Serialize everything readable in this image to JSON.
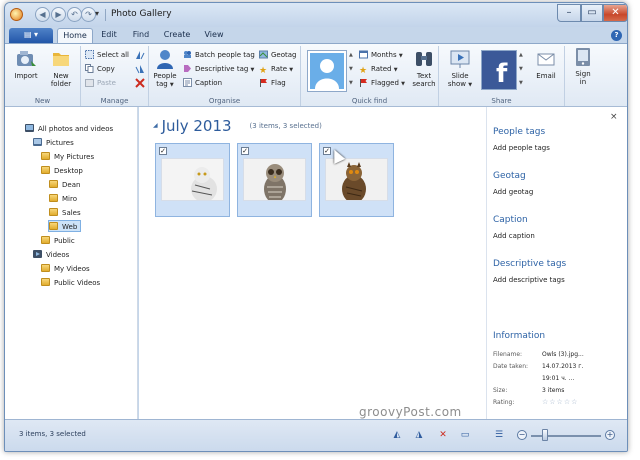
{
  "window": {
    "title": "Photo Gallery",
    "controls": {
      "minimize": "–",
      "maximize": "▭",
      "close": "✕"
    }
  },
  "menu": {
    "file_menu": "▤ ▾",
    "tabs": [
      "Home",
      "Edit",
      "Find",
      "Create",
      "View"
    ],
    "active_tab": "Home"
  },
  "ribbon": {
    "new_group": {
      "label": "New",
      "import": "Import",
      "new_folder_1": "New",
      "new_folder_2": "folder"
    },
    "manage_group": {
      "label": "Manage",
      "select_all": "Select all",
      "copy": "Copy",
      "paste": "Paste"
    },
    "organise_group": {
      "label": "Organise",
      "people_tag_1": "People",
      "people_tag_2": "tag",
      "batch_people_tag": "Batch people tag",
      "descriptive_tag": "Descriptive tag",
      "caption": "Caption",
      "geotag": "Geotag",
      "rate": "Rate",
      "flag": "Flag"
    },
    "quick_find_group": {
      "label": "Quick find",
      "months": "Months",
      "rated": "Rated",
      "flagged": "Flagged",
      "text_search_1": "Text",
      "text_search_2": "search"
    },
    "share_group": {
      "label": "Share",
      "slide_show_1": "Slide",
      "slide_show_2": "show",
      "email": "Email"
    },
    "sign_in": {
      "line1": "Sign",
      "line2": "in"
    }
  },
  "navigation": [
    {
      "label": "All photos and videos",
      "icon": "photos-icon",
      "level": 0
    },
    {
      "label": "Pictures",
      "icon": "pictures-icon",
      "level": 1
    },
    {
      "label": "My Pictures",
      "icon": "folder-icon",
      "level": 2
    },
    {
      "label": "Desktop",
      "icon": "folder-icon",
      "level": 2
    },
    {
      "label": "Dean",
      "icon": "folder-icon",
      "level": 3
    },
    {
      "label": "Miro",
      "icon": "folder-icon",
      "level": 3
    },
    {
      "label": "Sales",
      "icon": "folder-icon",
      "level": 3
    },
    {
      "label": "Web",
      "icon": "folder-icon",
      "level": 3,
      "selected": true
    },
    {
      "label": "Public",
      "icon": "folder-icon",
      "level": 2
    },
    {
      "label": "Videos",
      "icon": "videos-icon",
      "level": 1
    },
    {
      "label": "My Videos",
      "icon": "folder-icon",
      "level": 2
    },
    {
      "label": "Public Videos",
      "icon": "folder-icon",
      "level": 2
    }
  ],
  "gallery": {
    "group_arrow": "◢",
    "group_title": "July 2013",
    "group_count": "(3 items, 3 selected)",
    "checkmark": "✓",
    "photos": [
      {
        "name": "snowy-owl-photo",
        "checked": true
      },
      {
        "name": "barred-owl-photo",
        "checked": true
      },
      {
        "name": "eagle-owl-photo",
        "checked": true
      }
    ]
  },
  "details": {
    "close": "×",
    "people_tags": {
      "header": "People tags",
      "link": "Add people tags"
    },
    "geotag": {
      "header": "Geotag",
      "link": "Add geotag"
    },
    "caption": {
      "header": "Caption",
      "link": "Add caption"
    },
    "descriptive_tags": {
      "header": "Descriptive tags",
      "link": "Add descriptive tags"
    },
    "information": {
      "header": "Information",
      "filename_label": "Filename:",
      "filename_value": "Owls (3).jpg...",
      "date_label": "Date taken:",
      "date_value": "14.07.2013 г.",
      "time_value": "19:01 ч. ...",
      "size_label": "Size:",
      "size_value": "3 items",
      "rating_label": "Rating:",
      "rating_value": "☆☆☆☆☆"
    }
  },
  "watermark": "groovyPost.com",
  "status": {
    "text": "3 items, 3 selected",
    "zoom_minus": "−",
    "zoom_plus": "+"
  },
  "colors": {
    "accent": "#2e5c9c",
    "selection": "#cfe1f7",
    "ribbon": "#e0e9f4"
  }
}
